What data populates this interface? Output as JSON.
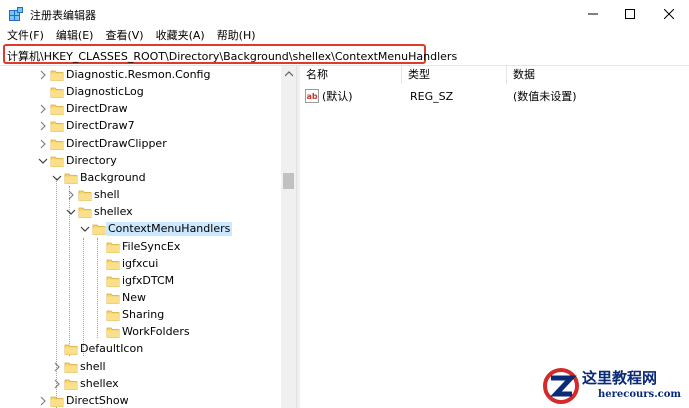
{
  "window": {
    "title": "注册表编辑器",
    "controls": {
      "minimize": "minimize-icon",
      "maximize": "maximize-icon",
      "close": "close-icon"
    }
  },
  "menu": [
    {
      "label": "文件(F)"
    },
    {
      "label": "编辑(E)"
    },
    {
      "label": "查看(V)"
    },
    {
      "label": "收藏夹(A)"
    },
    {
      "label": "帮助(H)"
    }
  ],
  "address": {
    "path": "计算机\\HKEY_CLASSES_ROOT\\Directory\\Background\\shellex\\ContextMenuHandlers"
  },
  "tree": {
    "items": [
      {
        "label": "Diagnostic.Resmon.Config",
        "expander": "collapsed"
      },
      {
        "label": "DiagnosticLog",
        "expander": "none"
      },
      {
        "label": "DirectDraw",
        "expander": "collapsed"
      },
      {
        "label": "DirectDraw7",
        "expander": "collapsed"
      },
      {
        "label": "DirectDrawClipper",
        "expander": "collapsed"
      },
      {
        "label": "Directory",
        "expander": "expanded"
      },
      {
        "label": "Background",
        "expander": "expanded"
      },
      {
        "label": "shell",
        "expander": "collapsed"
      },
      {
        "label": "shellex",
        "expander": "expanded"
      },
      {
        "label": "ContextMenuHandlers",
        "expander": "expanded",
        "selected": true
      },
      {
        "label": "FileSyncEx",
        "expander": "none"
      },
      {
        "label": "igfxcui",
        "expander": "none"
      },
      {
        "label": "igfxDTCM",
        "expander": "none"
      },
      {
        "label": "New",
        "expander": "none"
      },
      {
        "label": "Sharing",
        "expander": "none"
      },
      {
        "label": "WorkFolders",
        "expander": "none"
      },
      {
        "label": "DefaultIcon",
        "expander": "none"
      },
      {
        "label": "shell",
        "expander": "collapsed"
      },
      {
        "label": "shellex",
        "expander": "collapsed"
      },
      {
        "label": "DirectShow",
        "expander": "collapsed"
      }
    ]
  },
  "list": {
    "columns": [
      "名称",
      "类型",
      "数据"
    ],
    "rows": [
      {
        "name": "(默认)",
        "type": "REG_SZ",
        "data": "(数值未设置)",
        "icon": "string-value-icon"
      }
    ]
  },
  "watermark": {
    "title": "这里教程网",
    "url": "herecours.com"
  },
  "colors": {
    "address_border": "#e03a2a",
    "selection": "#cce8ff",
    "folder": "#f7d36b",
    "watermark_text": "#0a2a78"
  }
}
